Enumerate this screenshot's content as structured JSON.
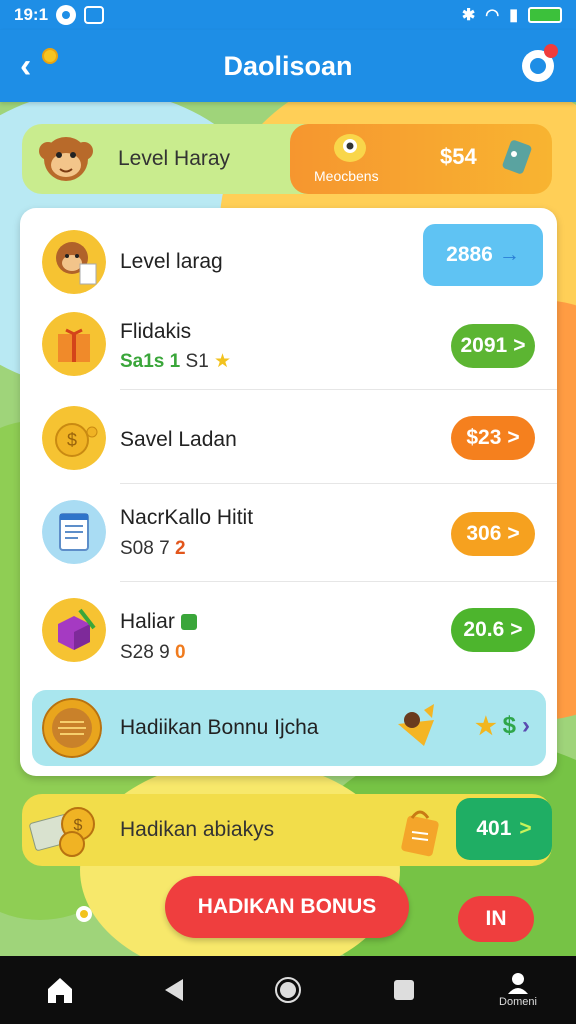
{
  "status_bar": {
    "time": "19:1"
  },
  "app_bar": {
    "title": "Daolisoan"
  },
  "top_row": {
    "label": "Level Haray",
    "sublabel": "Meocbens",
    "amount": "$54"
  },
  "list": [
    {
      "title": "Level larag",
      "subtitle": "",
      "pill": "2886",
      "pill_color": "#5fc3f3",
      "pill_arrow": "→"
    },
    {
      "title": "Flidakis",
      "subtitle": "Sa1s 1",
      "subtitle_extra": "S1",
      "pill": "2091",
      "pill_color": "#5cb532",
      "pill_arrow": ">"
    },
    {
      "title": "Savel Ladan",
      "subtitle": "",
      "pill": "$23",
      "pill_color": "#f5801e",
      "pill_arrow": ">"
    },
    {
      "title": "NacrKallo Hitit",
      "subtitle": "S08 7",
      "subtitle_extra": "2",
      "pill": "306",
      "pill_color": "#f6a11f",
      "pill_arrow": ">"
    },
    {
      "title": "Haliar",
      "subtitle": "S28 9",
      "subtitle_extra": "0",
      "pill": "20.6",
      "pill_color": "#4db52d",
      "pill_arrow": ">"
    }
  ],
  "bonus_row": {
    "label": "Hadiikan Bonnu Ijcha"
  },
  "strip": {
    "label": "Hadikan abiakys",
    "pill": "401",
    "pill_arrow": ">"
  },
  "buttons": {
    "bonus": "HADIKAN BONUS",
    "in": "IN"
  },
  "navbar": {
    "profile_label": "Domeni"
  },
  "colors": {
    "primary": "#1e8ee6",
    "accent_orange": "#f6962f",
    "accent_red": "#ef3e3e",
    "accent_green": "#1fae64"
  }
}
